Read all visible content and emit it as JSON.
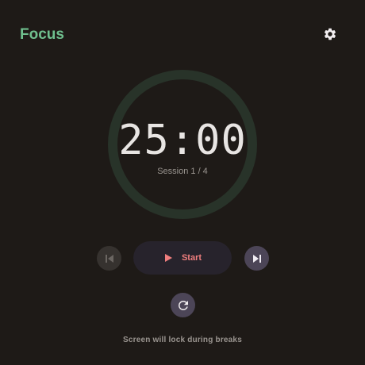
{
  "app": {
    "title": "Focus"
  },
  "timer": {
    "display": "25:00",
    "session_label": "Session 1 / 4",
    "progress": 0
  },
  "controls": {
    "start_label": "Start",
    "previous_enabled": false,
    "next_enabled": true
  },
  "footer": {
    "hint": "Screen will lock during breaks"
  },
  "icons": {
    "settings": "gear-icon",
    "previous": "skip-previous-icon",
    "play": "play-icon",
    "next": "skip-next-icon",
    "reset": "refresh-icon"
  },
  "colors": {
    "background": "#1e1a17",
    "accent": "#6fbf8e",
    "ring_track": "#283329",
    "text_primary": "#e8e5e3",
    "text_secondary": "#9a9590",
    "start_bg": "#27232c",
    "start_text": "#f07e7e",
    "nav_disabled_bg": "#36322f",
    "nav_disabled_icon": "#6b6662",
    "nav_enabled_bg": "#4c4557",
    "nav_enabled_icon": "#f0ecf3",
    "icon_light": "#f2eef0"
  }
}
